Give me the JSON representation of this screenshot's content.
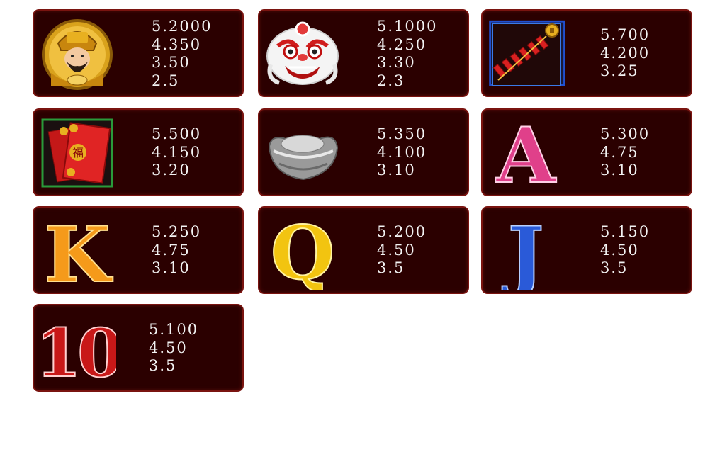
{
  "paytable": [
    {
      "symbol_icon": "god-of-wealth-icon",
      "pays": [
        "5.2000",
        "4.350",
        "3.50",
        "2.5"
      ]
    },
    {
      "symbol_icon": "lion-dance-head-icon",
      "pays": [
        "5.1000",
        "4.250",
        "3.30",
        "2.3"
      ]
    },
    {
      "symbol_icon": "firecrackers-icon",
      "pays": [
        "5.700",
        "4.200",
        "3.25"
      ]
    },
    {
      "symbol_icon": "red-envelope-icon",
      "pays": [
        "5.500",
        "4.150",
        "3.20"
      ]
    },
    {
      "symbol_icon": "silver-ingot-icon",
      "pays": [
        "5.350",
        "4.100",
        "3.10"
      ]
    },
    {
      "symbol_icon": "letter-a-icon",
      "pays": [
        "5.300",
        "4.75",
        "3.10"
      ]
    },
    {
      "symbol_icon": "letter-k-icon",
      "pays": [
        "5.250",
        "4.75",
        "3.10"
      ]
    },
    {
      "symbol_icon": "letter-q-icon",
      "pays": [
        "5.200",
        "4.50",
        "3.5"
      ]
    },
    {
      "symbol_icon": "letter-j-icon",
      "pays": [
        "5.150",
        "4.50",
        "3.5"
      ]
    },
    {
      "symbol_icon": "number-ten-icon",
      "pays": [
        "5.100",
        "4.50",
        "3.5"
      ]
    }
  ],
  "colors": {
    "card_bg": "#2b0000",
    "card_border": "#7a1410",
    "text": "#f2f2f2"
  }
}
